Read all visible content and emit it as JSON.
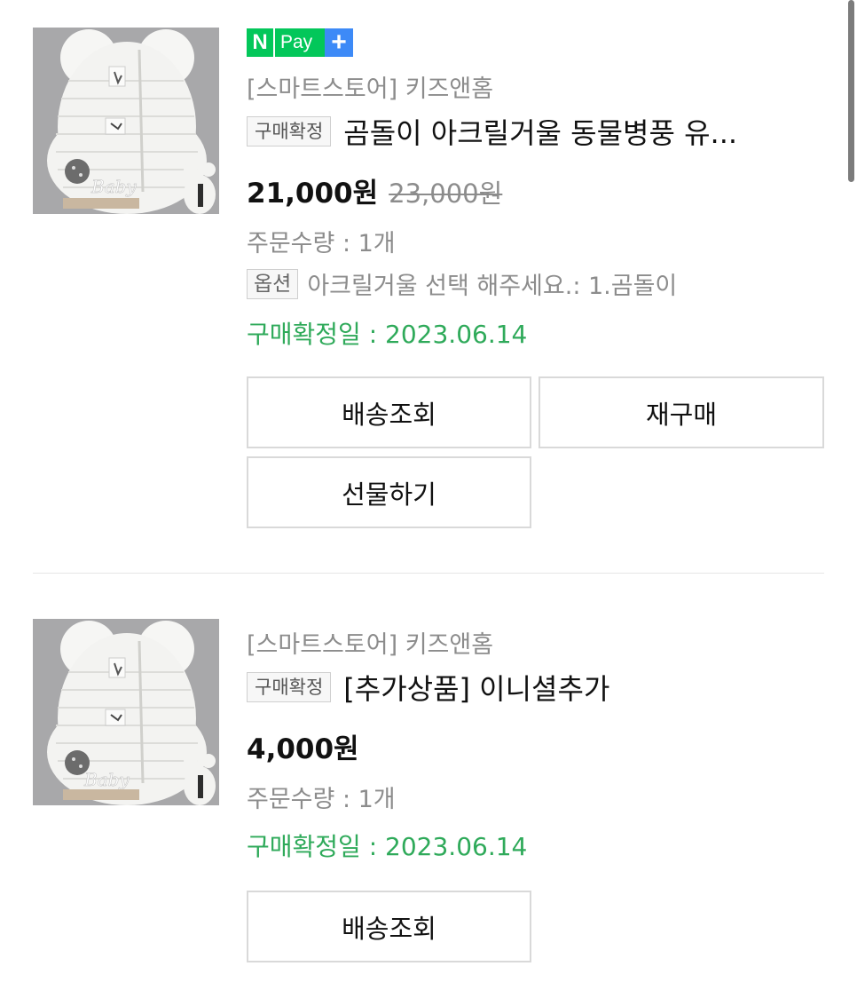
{
  "orders": [
    {
      "image_alt": "곰돌이 아크릴거울 동물병풍",
      "has_npay": true,
      "npay": {
        "n": "N",
        "pay": "Pay",
        "plus": "+"
      },
      "store": "[스마트스토어] 키즈앤홈",
      "status_badge": "구매확정",
      "title": "곰돌이 아크릴거울 동물병풍 유...",
      "price": "21,000원",
      "original_price": "23,000원",
      "quantity": "주문수량 : 1개",
      "option_badge": "옵션",
      "option_text": "아크릴거울 선택 해주세요.: 1.곰돌이",
      "confirm_date": "구매확정일 : 2023.06.14",
      "buttons": [
        "배송조회",
        "재구매",
        "선물하기"
      ]
    },
    {
      "image_alt": "곰돌이 아크릴거울 동물병풍",
      "has_npay": false,
      "store": "[스마트스토어] 키즈앤홈",
      "status_badge": "구매확정",
      "title": "[추가상품] 이니셜추가",
      "price": "4,000원",
      "quantity": "주문수량 : 1개",
      "confirm_date": "구매확정일 : 2023.06.14",
      "buttons": [
        "배송조회"
      ]
    }
  ],
  "colors": {
    "npay_green": "#03c75a",
    "npay_blue": "#3d8af7",
    "confirm_green": "#2faa5a",
    "muted_text": "#8c8c8c"
  }
}
